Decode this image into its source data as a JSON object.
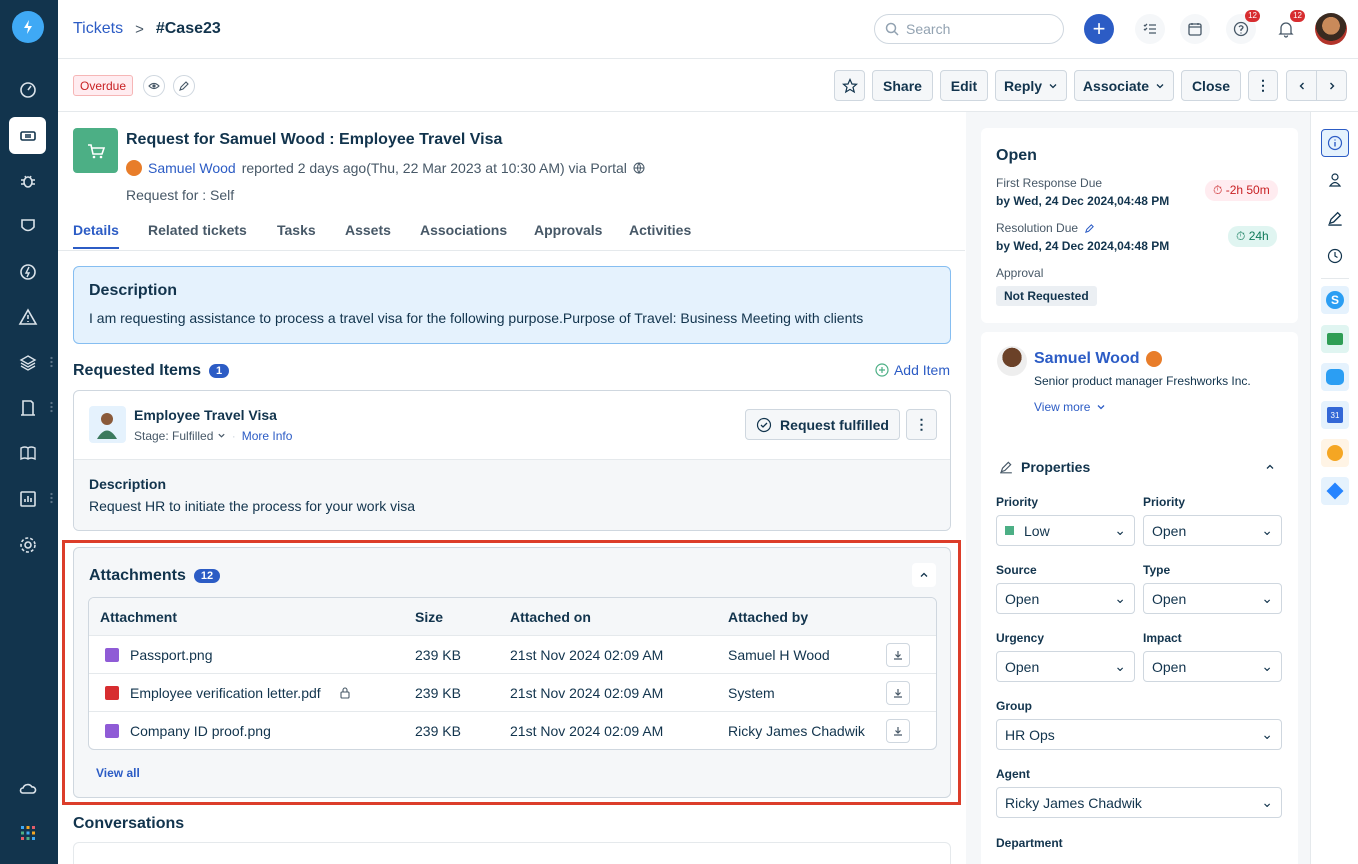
{
  "header": {
    "breadcrumb_root": "Tickets",
    "breadcrumb_sep": ">",
    "breadcrumb_current": "#Case23",
    "search_placeholder": "Search",
    "help_badge": "12",
    "notif_badge": "12"
  },
  "toolbar": {
    "status": "Overdue",
    "share": "Share",
    "edit": "Edit",
    "reply": "Reply",
    "associate": "Associate",
    "close": "Close"
  },
  "ticket": {
    "title": "Request for Samuel Wood : Employee Travel Visa",
    "requester": "Samuel Wood",
    "meta": "reported 2 days ago(Thu, 22 Mar 2023 at 10:30 AM) via Portal",
    "request_for": "Request for : Self"
  },
  "tabs": [
    "Details",
    "Related tickets",
    "Tasks",
    "Assets",
    "Associations",
    "Approvals",
    "Activities"
  ],
  "description": {
    "title": "Description",
    "text": "I am requesting assistance to process a travel visa for the following purpose.Purpose of Travel: Business Meeting with clients"
  },
  "requested_items": {
    "title": "Requested Items",
    "count": "1",
    "add_label": "Add Item",
    "item_name": "Employee Travel Visa",
    "stage": "Stage: Fulfilled",
    "more_info": "More Info",
    "fulfilled_label": "Request fulfilled",
    "desc_title": "Description",
    "desc_text": "Request HR to initiate the process for your work visa"
  },
  "attachments": {
    "title": "Attachments",
    "count": "12",
    "headers": [
      "Attachment",
      "Size",
      "Attached on",
      "Attached by"
    ],
    "rows": [
      {
        "name": "Passport.png",
        "size": "239 KB",
        "date": "21st Nov 2024 02:09 AM",
        "by": "Samuel H Wood",
        "type": "image"
      },
      {
        "name": "Employee verification letter.pdf",
        "size": "239 KB",
        "date": "21st Nov 2024 02:09 AM",
        "by": "System",
        "type": "pdf"
      },
      {
        "name": "Company ID proof.png",
        "size": "239 KB",
        "date": "21st Nov 2024 02:09 AM",
        "by": "Ricky James Chadwik",
        "type": "image"
      }
    ],
    "view_all": "View all"
  },
  "conversations": {
    "title": "Conversations"
  },
  "status_card": {
    "status": "Open",
    "first_response_label": "First Response Due",
    "first_response_value": "by Wed, 24 Dec 2024,04:48 PM",
    "first_response_sla": "-2h 50m",
    "resolution_label": "Resolution Due",
    "resolution_value": "by Wed, 24 Dec 2024,04:48 PM",
    "resolution_sla": "24h",
    "approval_label": "Approval",
    "approval_value": "Not Requested"
  },
  "contact": {
    "name": "Samuel Wood",
    "role": "Senior product manager Freshworks Inc.",
    "view_more": "View more"
  },
  "properties": {
    "title": "Properties",
    "fields": [
      {
        "label": "Priority",
        "value": "Low"
      },
      {
        "label": "Priority",
        "value": "Open"
      },
      {
        "label": "Source",
        "value": "Open"
      },
      {
        "label": "Type",
        "value": "Open"
      },
      {
        "label": "Urgency",
        "value": "Open"
      },
      {
        "label": "Impact",
        "value": "Open"
      },
      {
        "label": "Group",
        "value": "HR Ops"
      },
      {
        "label": "Agent",
        "value": "Ricky James Chadwik"
      },
      {
        "label": "Department",
        "value": ""
      }
    ]
  },
  "colors": {
    "brand": "#2c5cc5",
    "nav": "#12344d",
    "danger": "#dc3d2a",
    "success": "#4caf85"
  }
}
